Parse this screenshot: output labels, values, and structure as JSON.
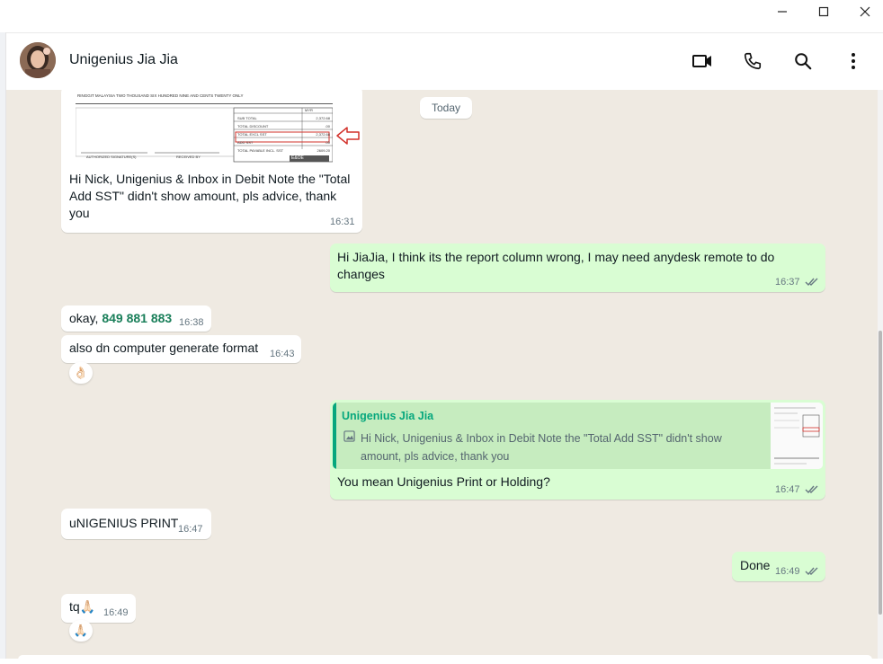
{
  "window": {
    "minimize_icon": "minimize-icon",
    "maximize_icon": "maximize-icon",
    "close_icon": "close-icon"
  },
  "contact": {
    "name": "Unigenius Jia Jia"
  },
  "header_icons": [
    "video-call-icon",
    "voice-call-icon",
    "search-icon",
    "menu-icon"
  ],
  "date_divider": "Today",
  "invoice_image": {
    "words_line": "RINGGIT MALAYSIA TWO THOUSAND SIX HUNDRED NINE AND CENTS TWENTY ONLY",
    "currency": "MYR",
    "rows": [
      {
        "label": "SUB TOTAL",
        "value": "2,372.68"
      },
      {
        "label": "TOTAL DISCOUNT",
        "value": ".00"
      },
      {
        "label": "TOTAL EXCL SST",
        "value": "2,372.68"
      },
      {
        "label": "ADD SST",
        "value": ".00"
      },
      {
        "label": "TOTAL PAYABLE INCL. SST",
        "value": "2609.20"
      }
    ],
    "sig1": "AUTHORIZED SIGNATURE(S)",
    "sig2": "RECEIVED BY",
    "stamp": "E&OE"
  },
  "messages": [
    {
      "dir": "in",
      "text": "Hi Nick, Unigenius & Inbox in Debit Note the \"Total Add SST\" didn't show amount, pls advice, thank you",
      "time": "16:31"
    },
    {
      "dir": "out",
      "text": "Hi JiaJia, I think its the report column wrong, I may need anydesk remote to do changes",
      "time": "16:37"
    },
    {
      "dir": "in",
      "text": "okay,",
      "phone": "849 881 883",
      "time": "16:38"
    },
    {
      "dir": "in",
      "text": "also dn computer generate format",
      "time": "16:43",
      "reaction": "👌🏻"
    },
    {
      "dir": "out",
      "quote_author": "Unigenius Jia Jia",
      "quote_text": "Hi Nick, Unigenius & Inbox in Debit Note the \"Total Add SST\" didn't show amount, pls advice, thank you",
      "text": "You mean Unigenius Print or Holding?",
      "time": "16:47"
    },
    {
      "dir": "in",
      "text": "uNIGENIUS PRINT",
      "time": "16:47"
    },
    {
      "dir": "out",
      "text": "Done",
      "time": "16:49"
    },
    {
      "dir": "in",
      "text": "tq🙏🏻",
      "time": "16:49",
      "reaction": "🙏🏻"
    }
  ],
  "colors": {
    "incoming": "#ffffff",
    "outgoing": "#d9fdd3",
    "wallpaper": "#efeae2",
    "accent": "#06a77d",
    "tick": "#667781"
  }
}
